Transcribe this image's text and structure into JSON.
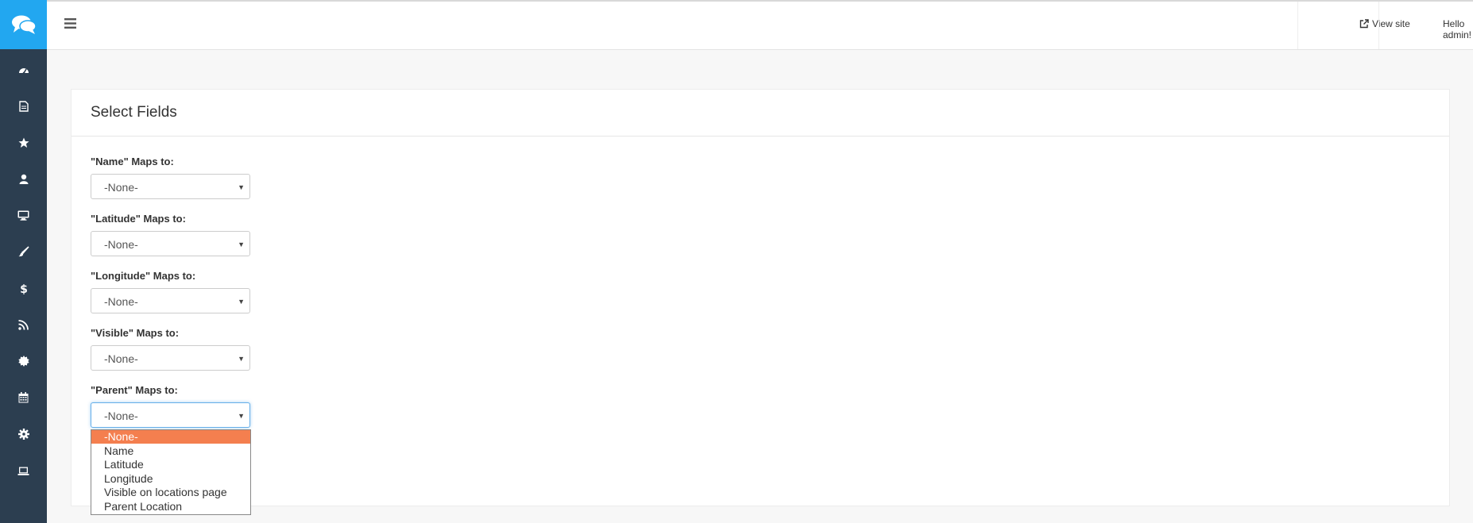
{
  "sidebar": {
    "items": [
      {
        "icon": "dashboard-icon"
      },
      {
        "icon": "document-icon"
      },
      {
        "icon": "star-icon"
      },
      {
        "icon": "user-icon"
      },
      {
        "icon": "desktop-icon"
      },
      {
        "icon": "paint-brush-icon"
      },
      {
        "icon": "dollar-icon"
      },
      {
        "icon": "rss-icon"
      },
      {
        "icon": "certificate-icon"
      },
      {
        "icon": "calendar-icon"
      },
      {
        "icon": "settings-icon"
      },
      {
        "icon": "laptop-icon"
      }
    ],
    "colors": {
      "background": "#2c3e50",
      "logo": "#22a7f0"
    }
  },
  "header": {
    "view_site": "View site",
    "user_menu": "Hello admin!"
  },
  "panel": {
    "title": "Select Fields",
    "fields": [
      {
        "label": "\"Name\" Maps to:",
        "value": "-None-"
      },
      {
        "label": "\"Latitude\" Maps to:",
        "value": "-None-"
      },
      {
        "label": "\"Longitude\" Maps to:",
        "value": "-None-"
      },
      {
        "label": "\"Visible\" Maps to:",
        "value": "-None-"
      },
      {
        "label": "\"Parent\" Maps to:",
        "value": "-None-"
      }
    ]
  },
  "dropdown": {
    "options": [
      "-None-",
      "Name",
      "Latitude",
      "Longitude",
      "Visible on locations page",
      "Parent Location"
    ],
    "selected": "-None-",
    "highlight_color": "#f47f4f"
  }
}
